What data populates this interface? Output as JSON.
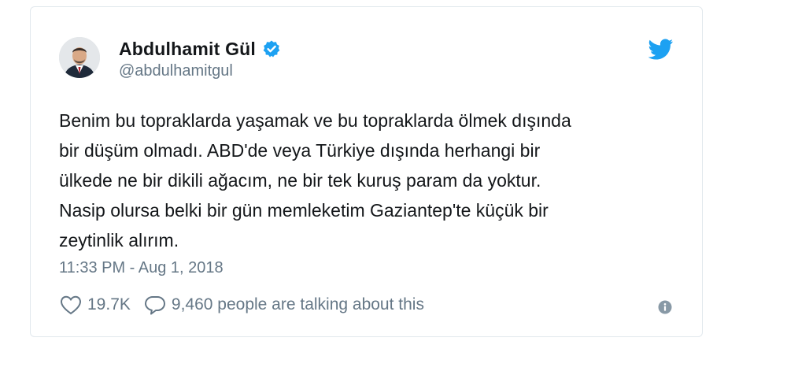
{
  "author": {
    "display_name": "Abdulhamit Gül",
    "handle": "@abdulhamitgul",
    "verified": true
  },
  "tweet": {
    "text_lines": [
      "Benim bu topraklarda yaşamak ve bu topraklarda ölmek dışında",
      "bir düşüm olmadı. ABD'de veya Türkiye dışında herhangi bir",
      "ülkede ne bir dikili ağacım, ne bir tek kuruş param da yoktur.",
      "Nasip olursa belki bir gün memleketim Gaziantep'te küçük bir",
      "zeytinlik alırım."
    ],
    "timestamp": "11:33 PM - Aug 1, 2018"
  },
  "actions": {
    "likes": "19.7K",
    "talking": "9,460 people are talking about this"
  },
  "icons": {
    "verified": "verified-badge-icon",
    "bird": "twitter-bird-icon",
    "like": "heart-icon",
    "reply": "speech-bubble-icon",
    "info": "info-icon"
  },
  "colors": {
    "twitter_blue": "#1da1f2",
    "text_primary": "#14171a",
    "text_secondary": "#657786",
    "border": "#e1e8ed"
  }
}
